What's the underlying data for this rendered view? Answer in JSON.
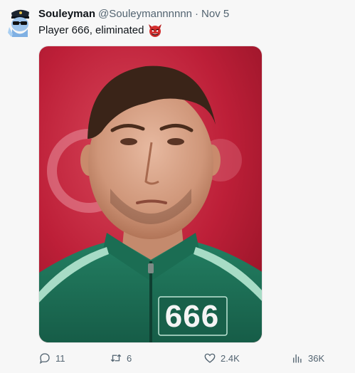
{
  "author": {
    "name": "Souleyman",
    "handle": "@Souleymannnnnn",
    "separator": "·",
    "date": "Nov 5"
  },
  "tweet": {
    "text": "Player 666, eliminated",
    "emoji_icon": "ogre-mask-icon"
  },
  "media": {
    "jersey_number": "666",
    "colors": {
      "background": "#c0203a",
      "jacket": "#1f7a5e",
      "stripe": "#a7dcc6"
    }
  },
  "actions": {
    "replies": "11",
    "reposts": "6",
    "likes": "2.4K",
    "views": "36K"
  }
}
